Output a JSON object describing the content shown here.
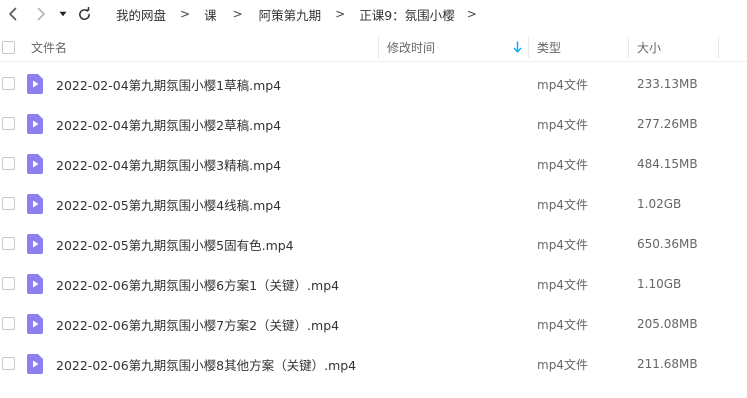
{
  "toolbar": {
    "breadcrumbs": [
      "我的网盘",
      "课",
      "阿策第九期",
      "正课9：氛围小樱"
    ],
    "separator": ">"
  },
  "columns": {
    "name": "文件名",
    "modified": "修改时间",
    "type": "类型",
    "size": "大小"
  },
  "files": [
    {
      "name": "2022-02-04第九期氛围小樱1草稿.mp4",
      "type": "mp4文件",
      "size": "233.13MB"
    },
    {
      "name": "2022-02-04第九期氛围小樱2草稿.mp4",
      "type": "mp4文件",
      "size": "277.26MB"
    },
    {
      "name": "2022-02-04第九期氛围小樱3精稿.mp4",
      "type": "mp4文件",
      "size": "484.15MB"
    },
    {
      "name": "2022-02-05第九期氛围小樱4线稿.mp4",
      "type": "mp4文件",
      "size": "1.02GB"
    },
    {
      "name": "2022-02-05第九期氛围小樱5固有色.mp4",
      "type": "mp4文件",
      "size": "650.36MB"
    },
    {
      "name": "2022-02-06第九期氛围小樱6方案1（关键）.mp4",
      "type": "mp4文件",
      "size": "1.10GB"
    },
    {
      "name": "2022-02-06第九期氛围小樱7方案2（关键）.mp4",
      "type": "mp4文件",
      "size": "205.08MB"
    },
    {
      "name": "2022-02-06第九期氛围小樱8其他方案（关键）.mp4",
      "type": "mp4文件",
      "size": "211.68MB"
    }
  ],
  "icons": {
    "back": "chevron-left-icon",
    "forward": "chevron-right-icon",
    "history": "caret-down-icon",
    "refresh": "refresh-icon",
    "sort": "sort-down-arrow-icon",
    "file": "video-file-icon"
  },
  "colors": {
    "accent": "#06a7ff",
    "file_icon": "#8c7ff0"
  }
}
